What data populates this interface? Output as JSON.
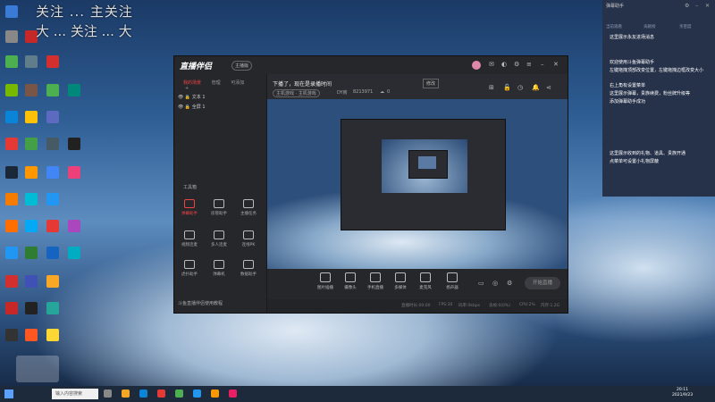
{
  "overlay": {
    "line1": "关注 ... 主关注",
    "line2": "大 ... 关注 ... 大"
  },
  "app": {
    "title": "直播伴侣",
    "badge": "主播版",
    "sidebar_tabs": [
      "我的场景",
      "管理",
      "可添加"
    ],
    "sources": [
      {
        "label": "文本 1"
      },
      {
        "label": "全屏 1"
      }
    ],
    "tools_header": "工具箱",
    "tools": [
      {
        "label": "弹幕助手",
        "active": true
      },
      {
        "label": "房管助手",
        "active": false
      },
      {
        "label": "主播任务",
        "active": false
      },
      {
        "label": "视频连麦",
        "active": false
      },
      {
        "label": "多人连麦",
        "active": false
      },
      {
        "label": "连线PK",
        "active": false
      },
      {
        "label": "虎扑助手",
        "active": false
      },
      {
        "label": "弹幕机",
        "active": false
      },
      {
        "label": "数据助手",
        "active": false
      }
    ],
    "status_left": "斗鱼直播伴侣使用教程"
  },
  "stream": {
    "title": "下播了，现在是录播时间",
    "modify_label": "修改",
    "category": "主机游戏 · 主机游戏",
    "room_label": "DY房",
    "room_id": "8213971",
    "viewers": "0"
  },
  "bottom_buttons": [
    "图片插播",
    "摄像头",
    "手机直播",
    "多媒体",
    "麦克风",
    "扬声器"
  ],
  "start_button": "开始直播",
  "status_bar": [
    "直播时长:00:00",
    "FPS:30",
    "码率:0kbps",
    "丢帧:0(0%)",
    "CPU:2%",
    "内存:1.2G"
  ],
  "danmu_panel": {
    "title": "弹幕助手",
    "stats": [
      "当前观看",
      "贡献榜",
      "亲密度"
    ],
    "messages": [
      "这里展示永友进场消息",
      "欢迎使用斗鱼弹幕助手",
      "左键拖拽顶部改变位置，左键拖拽边框改变大小",
      "右上角有设置菜单",
      "这里展示弹幕，贵族续费，粉丝牌升级等",
      "添加弹幕助手成功",
      "这里展示收到的礼物、道具、贵族开通",
      "点菜单可设置小礼物屏蔽"
    ]
  },
  "taskbar": {
    "search_placeholder": "输入内容搜索",
    "time": "20:11",
    "date": "2021/9/23"
  },
  "colors": {
    "accent": "#e44444",
    "window_bg": "#2b2c31",
    "panel_bg": "#26324a"
  }
}
